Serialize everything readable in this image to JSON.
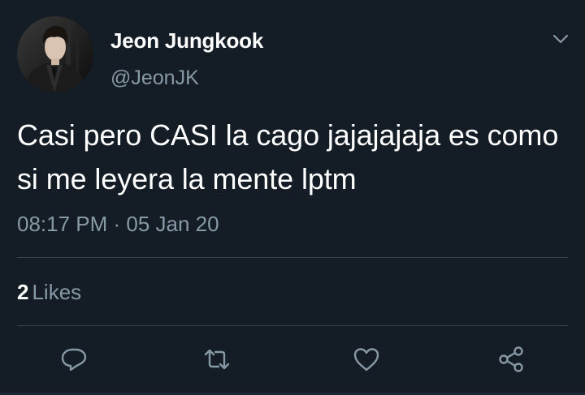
{
  "tweet": {
    "display_name": "Jeon Jungkook",
    "handle": "@JeonJK",
    "text": "Casi pero CASI la cago jajajajaja es como si me leyera la mente lptm",
    "timestamp": "08:17 PM · 05 Jan 20",
    "likes_count": "2",
    "likes_label": "Likes"
  },
  "icons": {
    "menu": "chevron-down-icon",
    "reply": "reply-icon",
    "retweet": "retweet-icon",
    "like": "heart-icon",
    "share": "share-icon"
  },
  "colors": {
    "background": "#141d26",
    "primary_text": "#ffffff",
    "secondary_text": "#8899a6",
    "divider": "#38444d"
  }
}
